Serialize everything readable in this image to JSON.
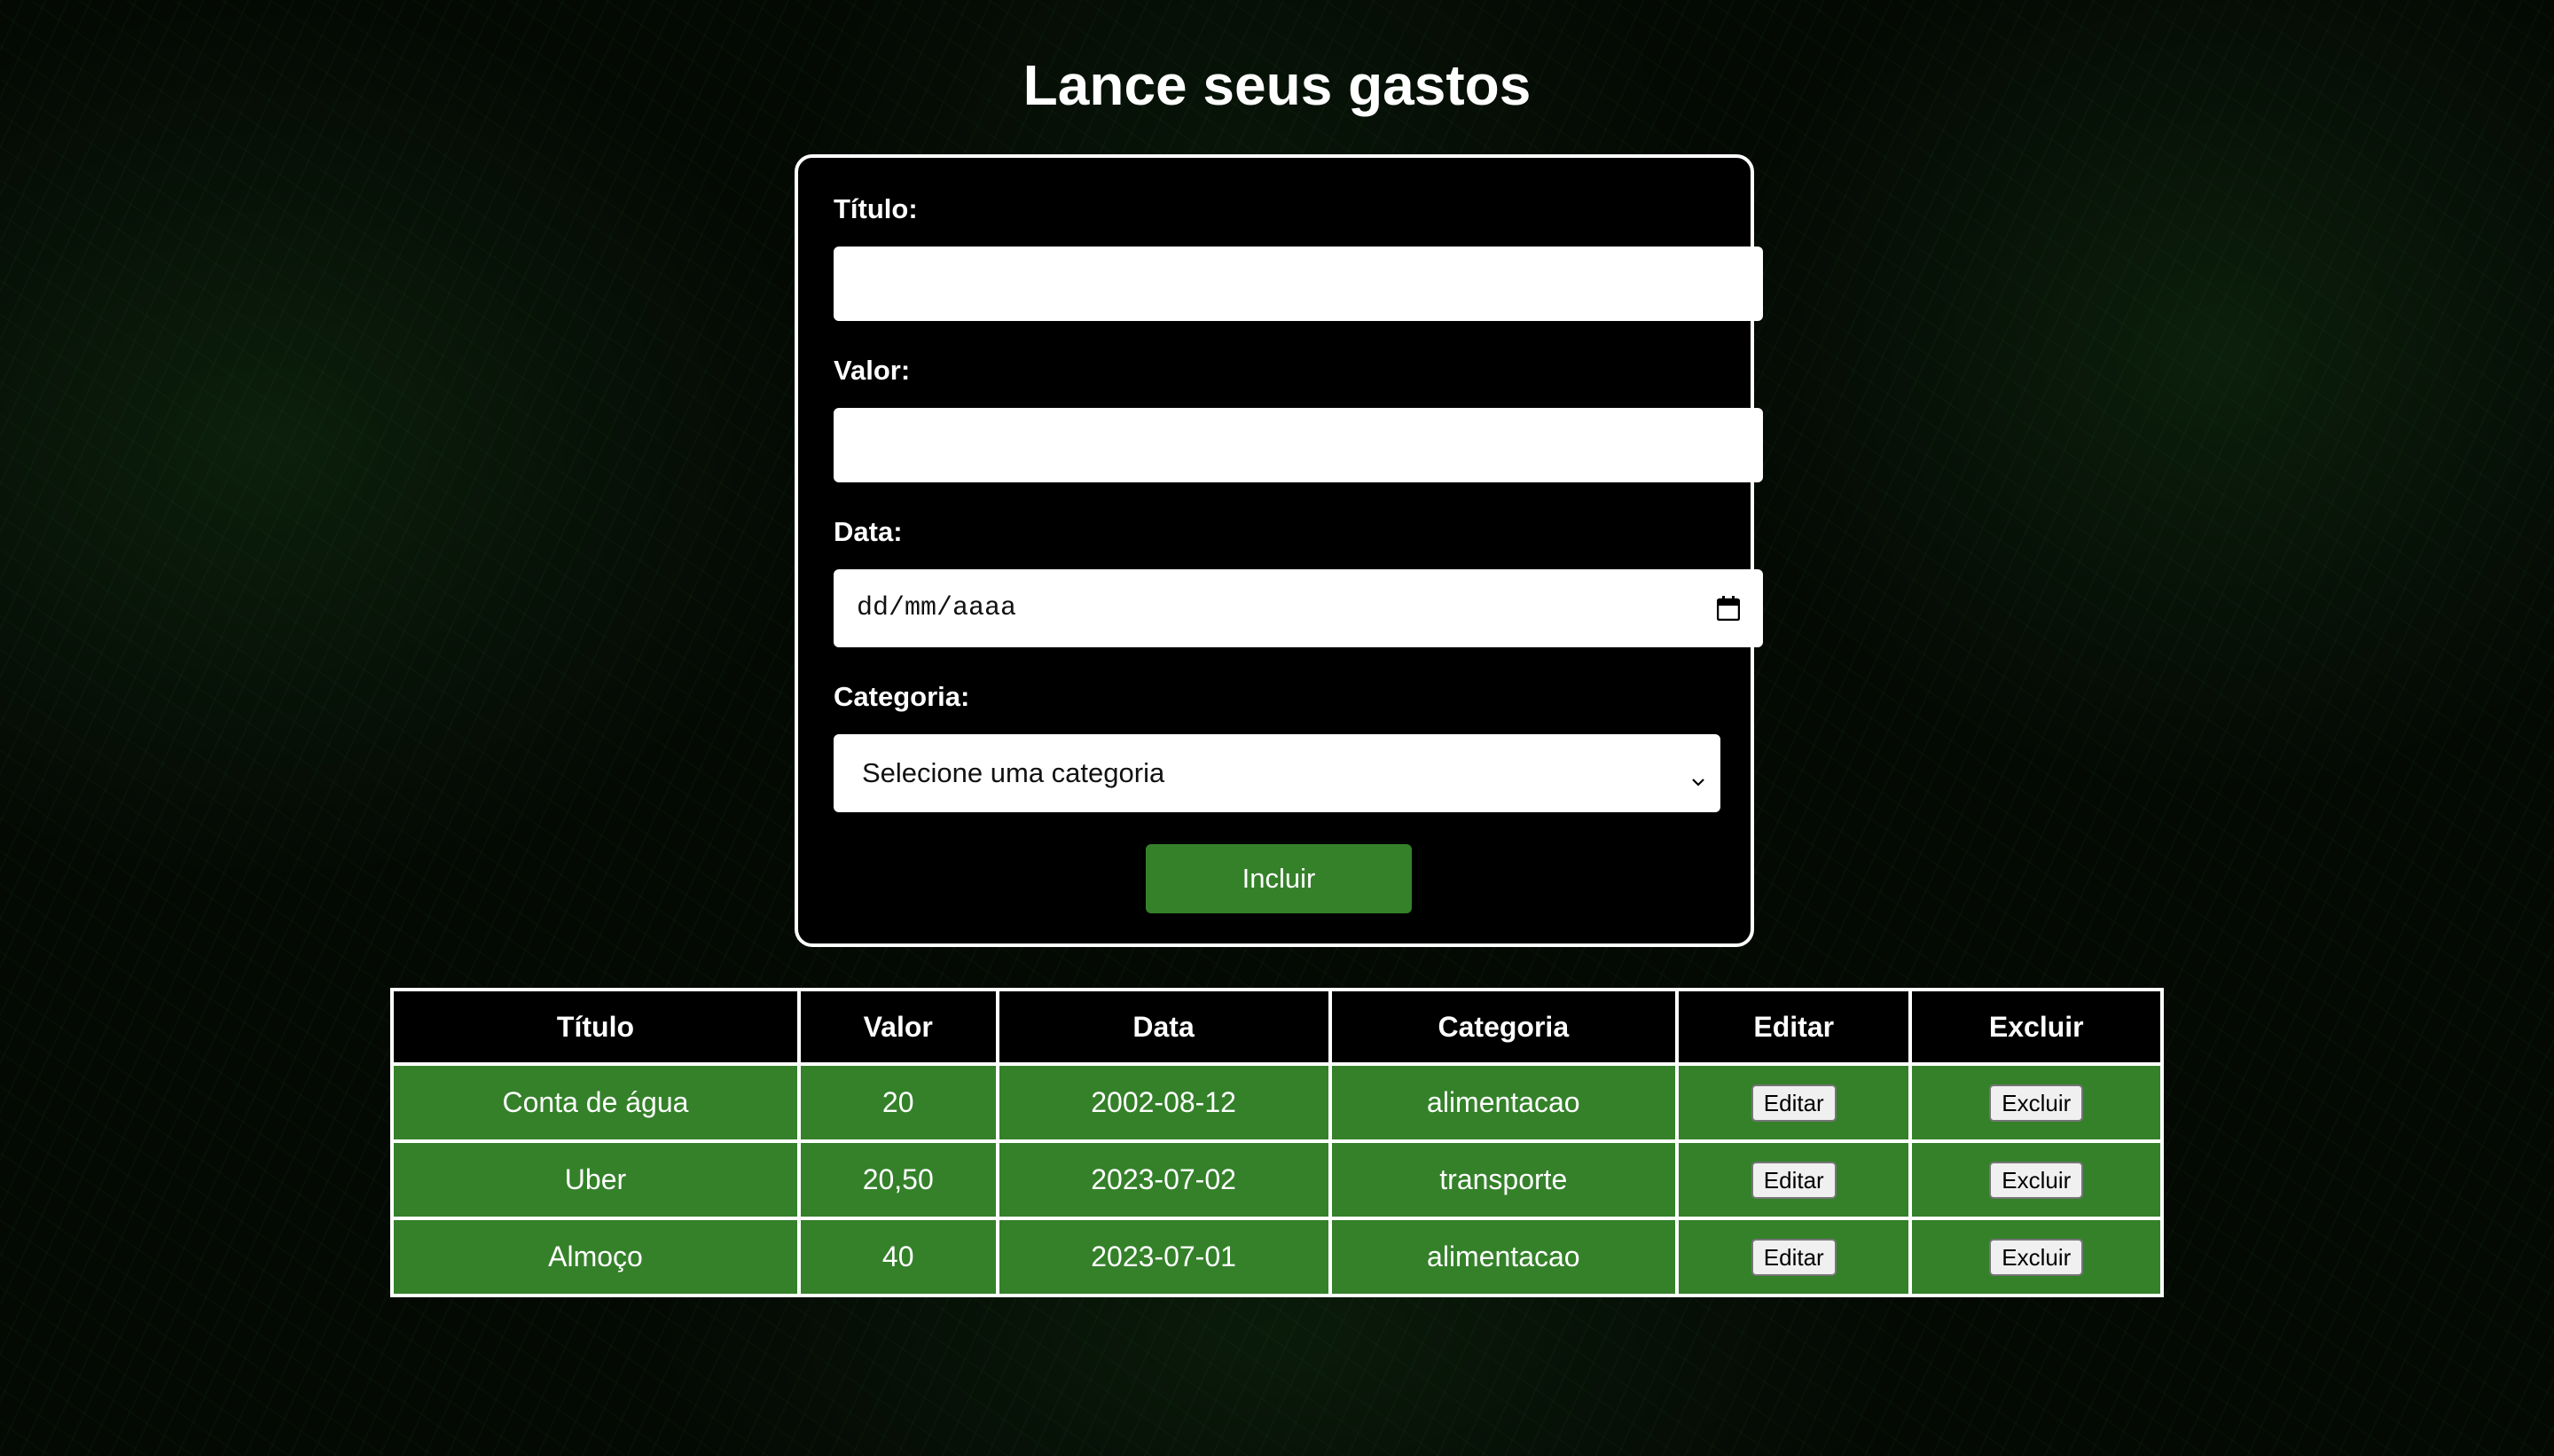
{
  "page": {
    "title": "Lance seus gastos"
  },
  "form": {
    "titulo_label": "Título:",
    "titulo_value": "",
    "valor_label": "Valor:",
    "valor_value": "",
    "data_label": "Data:",
    "data_placeholder": "dd/mm/aaaa",
    "categoria_label": "Categoria:",
    "categoria_selected": "Selecione uma categoria",
    "submit_label": "Incluir"
  },
  "table": {
    "headers": [
      "Título",
      "Valor",
      "Data",
      "Categoria",
      "Editar",
      "Excluir"
    ],
    "rows": [
      {
        "titulo": "Conta de água",
        "valor": "20",
        "data": "2002-08-12",
        "categoria": "alimentacao",
        "edit_label": "Editar",
        "delete_label": "Excluir"
      },
      {
        "titulo": "Uber",
        "valor": "20,50",
        "data": "2023-07-02",
        "categoria": "transporte",
        "edit_label": "Editar",
        "delete_label": "Excluir"
      },
      {
        "titulo": "Almoço",
        "valor": "40",
        "data": "2023-07-01",
        "categoria": "alimentacao",
        "edit_label": "Editar",
        "delete_label": "Excluir"
      }
    ]
  },
  "colors": {
    "accent_green": "#35812a",
    "card_background": "#000000",
    "page_background": "#040904"
  },
  "icons": {
    "date_picker": "calendar-icon",
    "select_arrow": "chevron-down-icon"
  }
}
